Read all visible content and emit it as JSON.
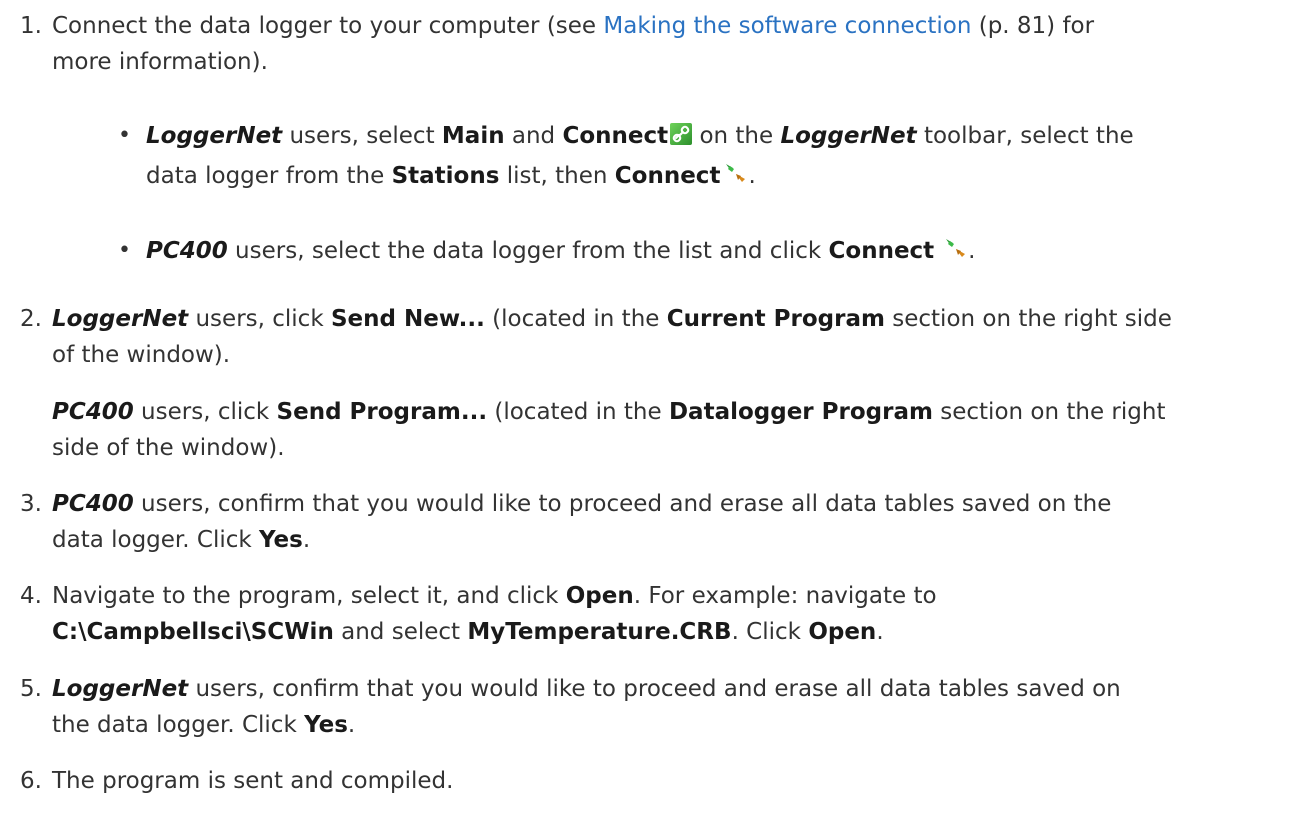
{
  "steps": [
    {
      "number": "1.",
      "parts": {
        "a": "Connect the data logger to your computer (see ",
        "link": "Making the software connection",
        "b": " (p. 81) for",
        "c": "more information)."
      },
      "bullets": [
        {
          "product": "LoggerNet",
          "t1": " users, select ",
          "ui1": "Main",
          "t2": " and ",
          "ui2": "Connect",
          "t3": " on the ",
          "product2": "LoggerNet",
          "t4": " toolbar, select the",
          "t5": "data logger from the ",
          "ui3": "Stations",
          "t6": " list, then ",
          "ui4": "Connect",
          "t7": "."
        },
        {
          "product": "PC400",
          "t1": " users, select the data logger from the list and click ",
          "ui1": "Connect",
          "t2": "."
        }
      ]
    },
    {
      "number": "2.",
      "line1": {
        "product": "LoggerNet",
        "t1": " users, click ",
        "ui1": "Send New...",
        "t2": " (located in the ",
        "ui2": "Current Program",
        "t3": " section on the right side"
      },
      "line2": "of the window).",
      "line3": {
        "product": "PC400",
        "t1": " users, click ",
        "ui1": "Send Program...",
        "t2": " (located in the ",
        "ui2": "Datalogger Program",
        "t3": " section on the right"
      },
      "line4": "side of the window)."
    },
    {
      "number": "3.",
      "line1": {
        "product": "PC400",
        "t1": " users, confirm that you would like to proceed and erase all data tables saved on the"
      },
      "line2": {
        "t1": "data logger. Click ",
        "ui1": "Yes",
        "t2": "."
      }
    },
    {
      "number": "4.",
      "line1": {
        "t1": "Navigate to the program, select it, and click ",
        "ui1": "Open",
        "t2": ". For example: navigate to"
      },
      "line2": {
        "ui1": "C:\\Campbellsci\\SCWin",
        "t1": " and select ",
        "ui2": "MyTemperature.CRB",
        "t2": ". Click ",
        "ui3": "Open",
        "t3": "."
      }
    },
    {
      "number": "5.",
      "line1": {
        "product": "LoggerNet",
        "t1": " users, confirm that you would like to proceed and erase all data tables saved on"
      },
      "line2": {
        "t1": "the data logger. Click ",
        "ui1": "Yes",
        "t2": "."
      }
    },
    {
      "number": "6.",
      "line1": "The program is sent and compiled."
    }
  ],
  "icons": {
    "connect_toolbar": "connect-link-icon",
    "connect_plug": "plug-connect-icon"
  },
  "colors": {
    "link": "#2a72c2",
    "text": "#333333",
    "icon_green": "#3aa63a",
    "plug_orange": "#d98a1c"
  }
}
